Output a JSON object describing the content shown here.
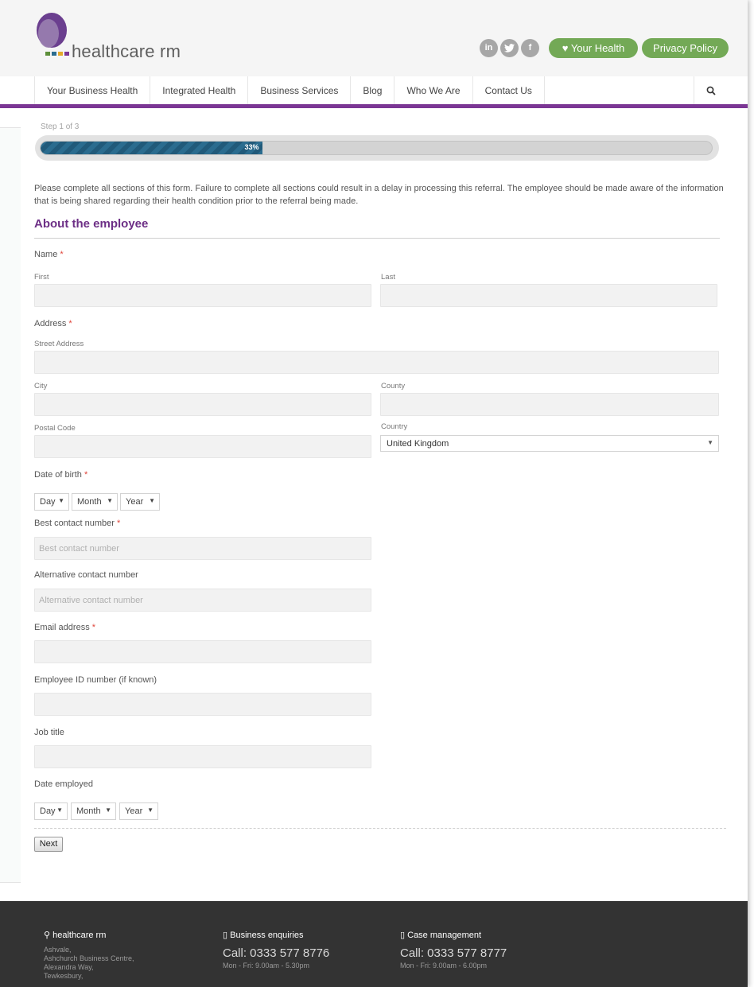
{
  "brand": {
    "name": "healthcare rm",
    "accent": "#7b3694",
    "green": "#73a956"
  },
  "header": {
    "social": [
      {
        "icon": "linkedin-icon",
        "glyph": "in"
      },
      {
        "icon": "twitter-icon",
        "glyph": "t"
      },
      {
        "icon": "facebook-icon",
        "glyph": "f"
      }
    ],
    "your_health_label": "Your Health",
    "privacy_label": "Privacy Policy"
  },
  "nav": {
    "items": [
      "Your Business Health",
      "Integrated Health",
      "Business Services",
      "Blog",
      "Who We Are",
      "Contact Us"
    ],
    "search_icon": "search-icon"
  },
  "progress": {
    "step_text": "Step 1 of 3",
    "percent": 33,
    "label": "33%"
  },
  "form": {
    "intro": "Please complete all sections of this form. Failure to complete all sections could result in a delay in processing this referral. The employee should be made aware of the information that is being shared regarding their health condition prior to the referral being made.",
    "section_title": "About the employee",
    "required_mark": "*",
    "name": {
      "label": "Name",
      "first": "First",
      "last": "Last"
    },
    "address": {
      "label": "Address",
      "street": "Street Address",
      "city": "City",
      "county": "County",
      "postal": "Postal Code",
      "country_label": "Country",
      "country_value": "United Kingdom"
    },
    "dob": {
      "label": "Date of birth",
      "day": "Day",
      "month": "Month",
      "year": "Year"
    },
    "best_contact": {
      "label": "Best contact number",
      "placeholder": "Best contact number"
    },
    "alt_contact": {
      "label": "Alternative contact number",
      "placeholder": "Alternative contact number"
    },
    "email": {
      "label": "Email address"
    },
    "employee_id": {
      "label": "Employee ID number (if known)"
    },
    "job_title": {
      "label": "Job title"
    },
    "date_employed": {
      "label": "Date employed",
      "day": "Day",
      "month": "Month",
      "year": "Year"
    },
    "next_label": "Next"
  },
  "footer": {
    "company": {
      "title": "healthcare rm",
      "lines": [
        "Ashvale,",
        "Ashchurch Business Centre,",
        "Alexandra Way,",
        "Tewkesbury,"
      ]
    },
    "business": {
      "title": "Business enquiries",
      "call": "Call: 0333 577 8776",
      "hours": "Mon - Fri: 9.00am - 5.30pm"
    },
    "case": {
      "title": "Case management",
      "call": "Call: 0333 577 8777",
      "hours": "Mon - Fri: 9.00am - 6.00pm"
    }
  }
}
